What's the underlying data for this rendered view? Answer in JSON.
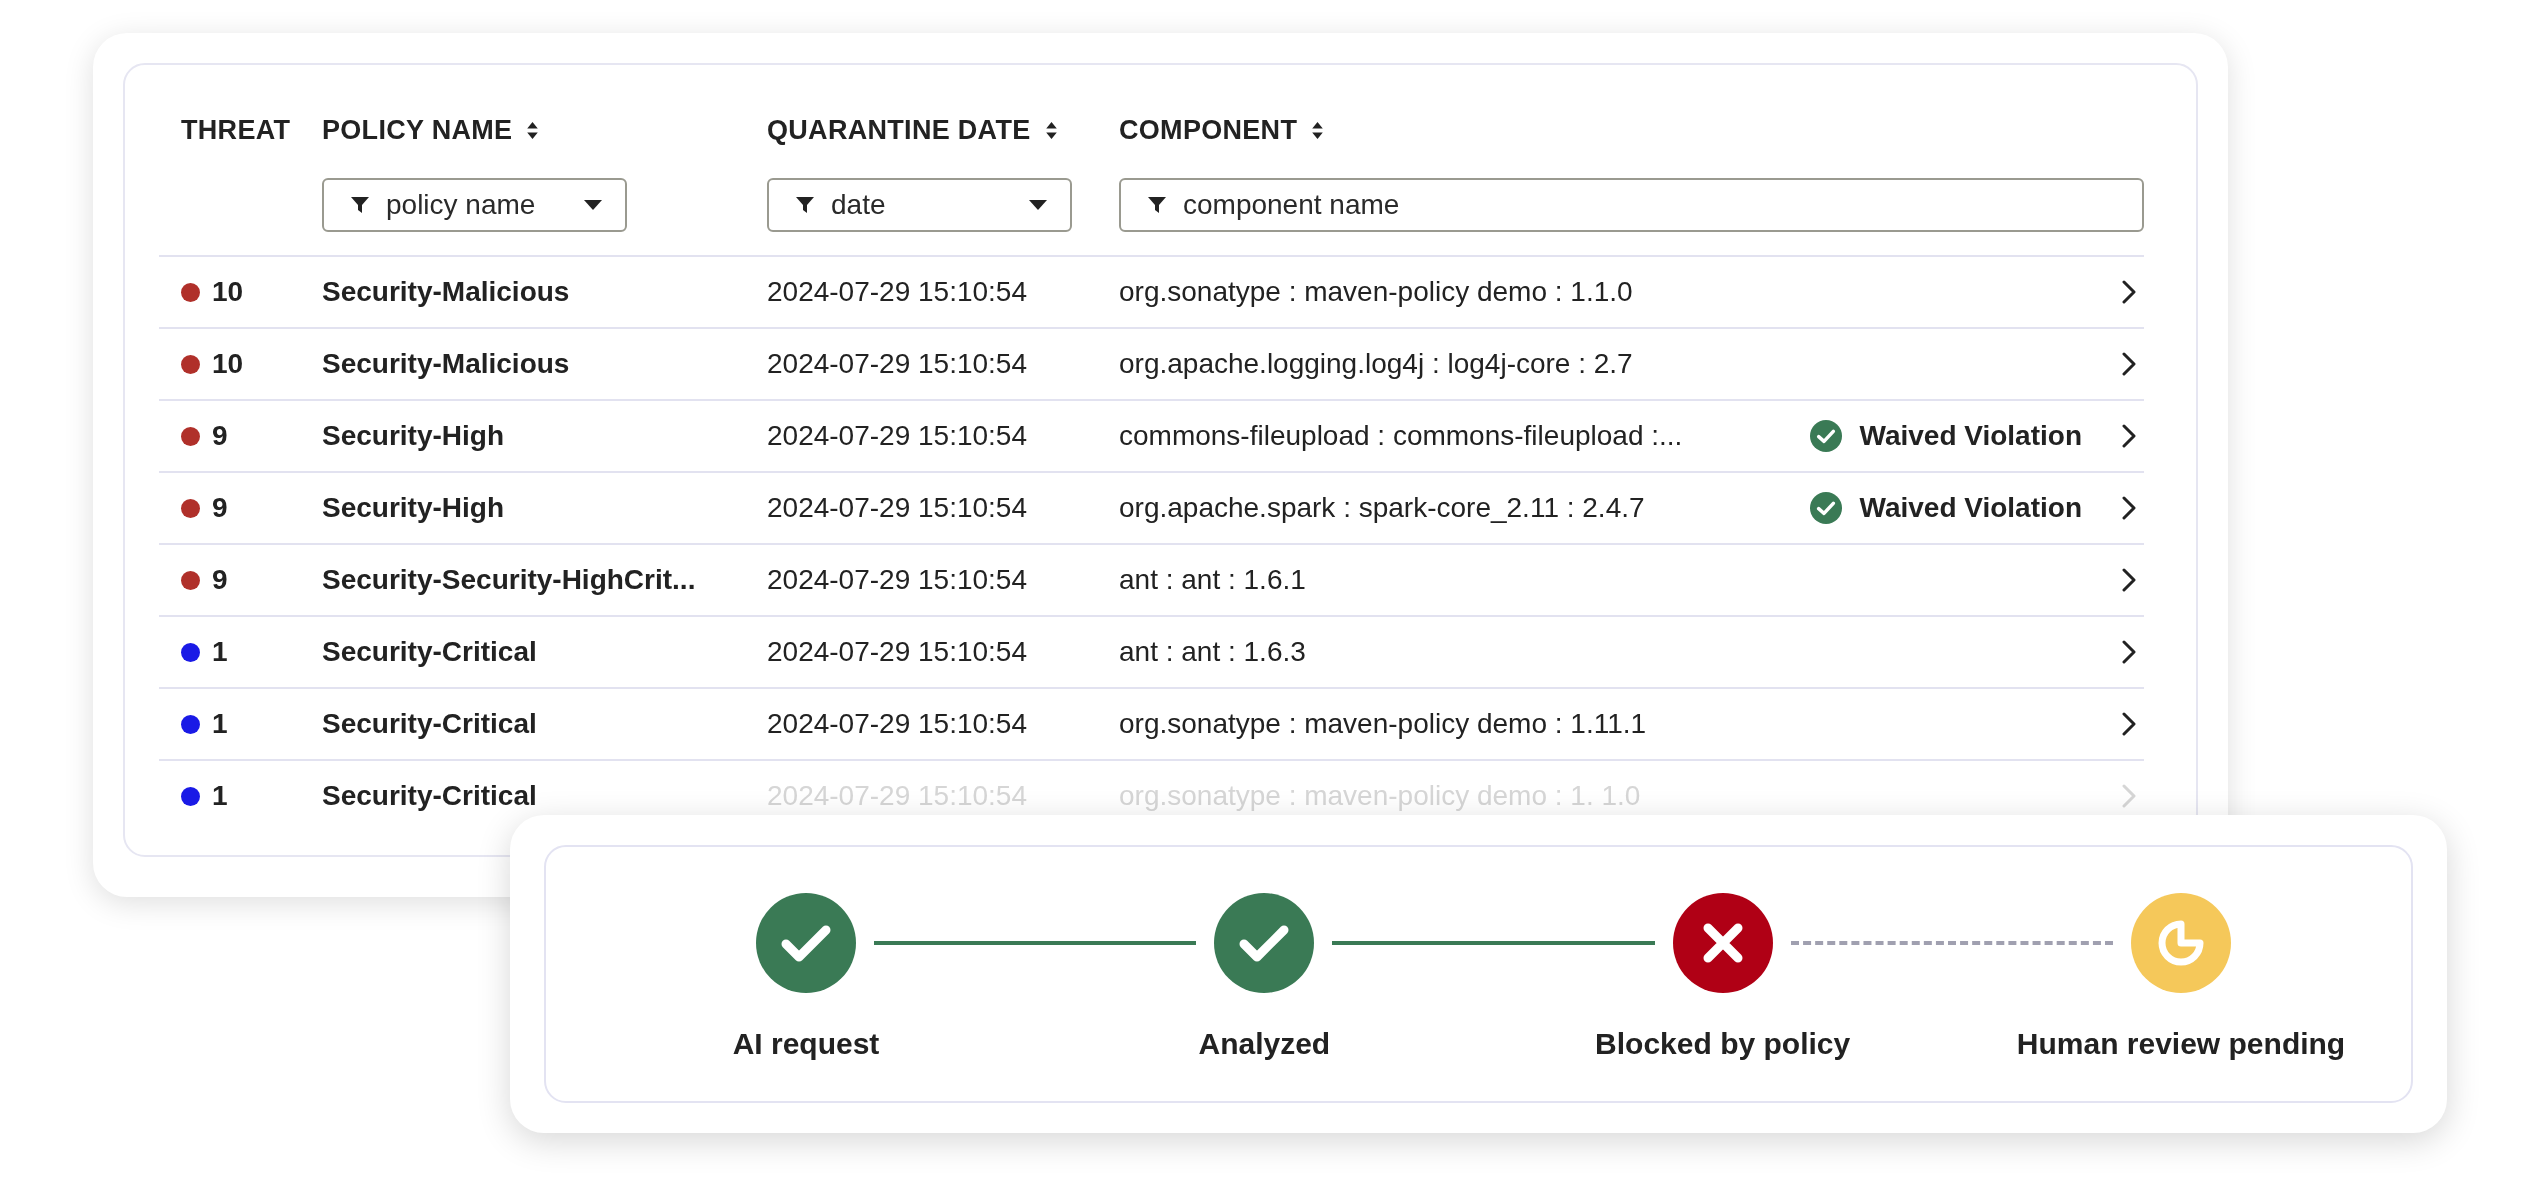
{
  "table": {
    "columns": [
      {
        "label": "THREAT",
        "sortable": false
      },
      {
        "label": "POLICY NAME",
        "sortable": true
      },
      {
        "label": "QUARANTINE DATE",
        "sortable": true
      },
      {
        "label": "COMPONENT",
        "sortable": true
      }
    ],
    "filters": [
      {
        "placeholder": "policy name",
        "dropdown": true
      },
      {
        "placeholder": "date",
        "dropdown": true
      },
      {
        "placeholder": "component name",
        "dropdown": false
      }
    ],
    "rows": [
      {
        "threat": "10",
        "color": "#b0302a",
        "policy": "Security-Malicious",
        "date": "2024-07-29 15:10:54",
        "component": "org.sonatype : maven-policy demo : 1.1.0",
        "faded": false
      },
      {
        "threat": "10",
        "color": "#b0302a",
        "policy": "Security-Malicious",
        "date": "2024-07-29 15:10:54",
        "component": "org.apache.logging.log4j : log4j-core : 2.7",
        "faded": false
      },
      {
        "threat": "9",
        "color": "#b0302a",
        "policy": "Security-High",
        "date": "2024-07-29 15:10:54",
        "component": "commons-fileupload : commons-fileupload :...",
        "status": "Waived Violation",
        "faded": false
      },
      {
        "threat": "9",
        "color": "#b0302a",
        "policy": "Security-High",
        "date": "2024-07-29 15:10:54",
        "component": "org.apache.spark : spark-core_2.11 : 2.4.7",
        "status": "Waived Violation",
        "faded": false
      },
      {
        "threat": "9",
        "color": "#b0302a",
        "policy": "Security-Security-HighCrit...",
        "date": "2024-07-29 15:10:54",
        "component": "ant : ant : 1.6.1",
        "faded": false
      },
      {
        "threat": "1",
        "color": "#1a1ae6",
        "policy": "Security-Critical",
        "date": "2024-07-29 15:10:54",
        "component": "ant : ant : 1.6.3",
        "faded": false
      },
      {
        "threat": "1",
        "color": "#1a1ae6",
        "policy": "Security-Critical",
        "date": "2024-07-29 15:10:54",
        "component": "org.sonatype : maven-policy demo : 1.11.1",
        "faded": false
      },
      {
        "threat": "1",
        "color": "#1a1ae6",
        "policy": "Security-Critical",
        "date": "2024-07-29 15:10:54",
        "component": "org.sonatype : maven-policy demo : 1. 1.0",
        "faded": true
      }
    ]
  },
  "steps": [
    {
      "label": "AI request",
      "kind": "done"
    },
    {
      "label": "Analyzed",
      "kind": "done"
    },
    {
      "label": "Blocked by policy",
      "kind": "blocked"
    },
    {
      "label": "Human review pending",
      "kind": "pending"
    }
  ]
}
